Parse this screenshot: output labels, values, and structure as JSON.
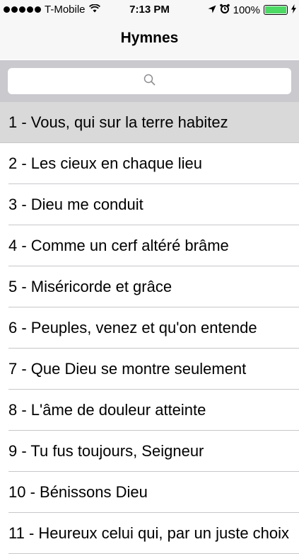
{
  "status_bar": {
    "carrier": "T-Mobile",
    "time": "7:13 PM",
    "battery": "100%"
  },
  "nav": {
    "title": "Hymnes"
  },
  "search": {
    "placeholder": ""
  },
  "hymns": [
    "1 - Vous, qui sur la terre habitez",
    "2 - Les cieux en chaque lieu",
    "3 - Dieu me conduit",
    "4 - Comme un cerf altéré brâme",
    "5 - Miséricorde et grâce",
    "6 - Peuples, venez et qu'on entende",
    "7 - Que Dieu se montre seulement",
    "8 - L'âme de douleur atteinte",
    "9 - Tu fus toujours, Seigneur",
    "10 - Bénissons Dieu",
    "11 - Heureux celui qui, par un juste choix"
  ],
  "colors": {
    "selected_row": "#d9d9d9",
    "battery": "#4cd964",
    "search_bar_bg": "#c9c9ce"
  }
}
